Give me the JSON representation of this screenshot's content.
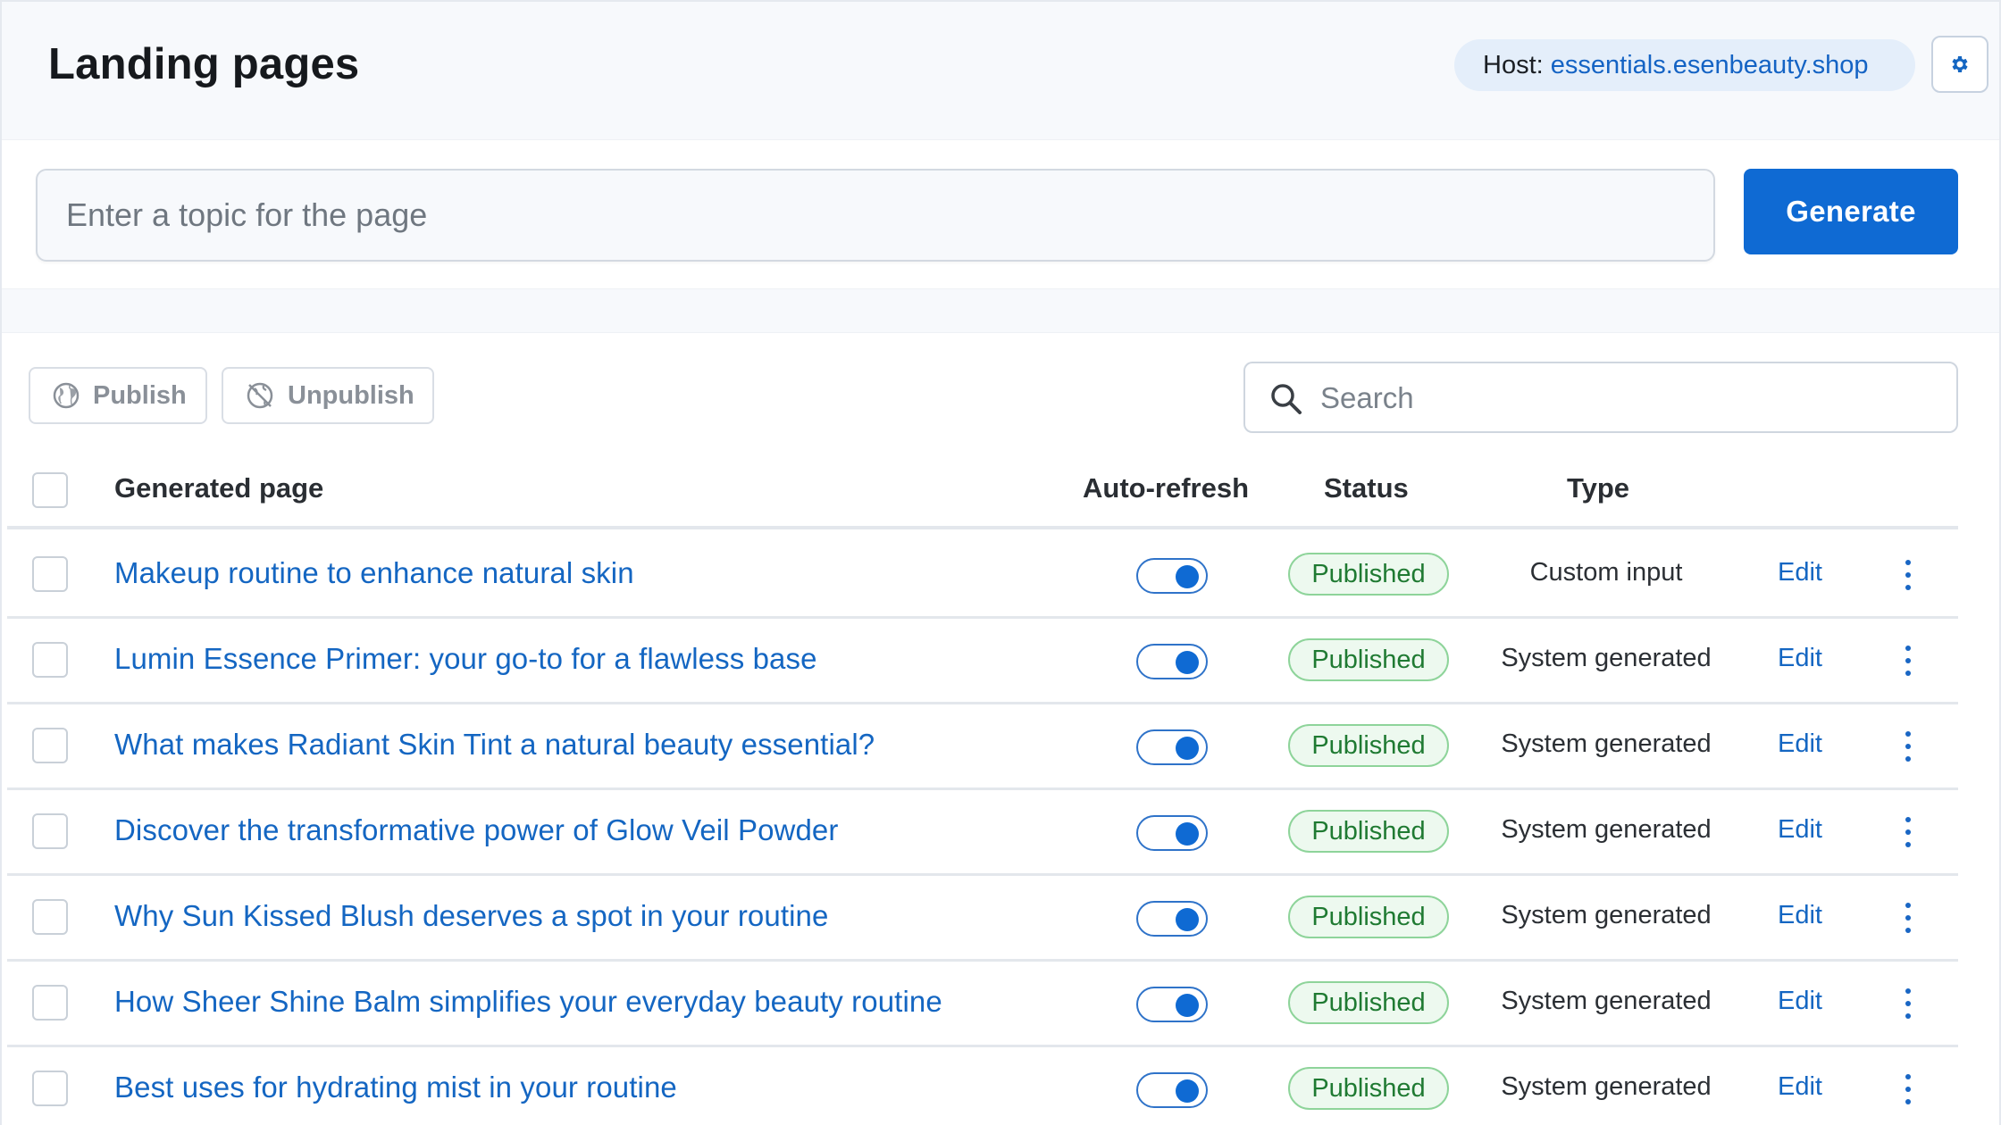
{
  "header": {
    "title": "Landing pages",
    "host_label": "Host:",
    "host_value": "essentials.esenbeauty.shop",
    "settings_icon": "gear-icon"
  },
  "generator": {
    "topic_placeholder": "Enter a topic for the page",
    "topic_value": "",
    "generate_label": "Generate"
  },
  "toolbar": {
    "publish_label": "Publish",
    "publish_icon": "globe-icon",
    "unpublish_label": "Unpublish",
    "unpublish_icon": "globe-off-icon",
    "search_placeholder": "Search",
    "search_icon": "search-icon"
  },
  "table": {
    "columns": {
      "page": "Generated page",
      "auto_refresh": "Auto-refresh",
      "status": "Status",
      "type": "Type"
    },
    "rows": [
      {
        "title": "Makeup routine to enhance natural skin",
        "auto_refresh": true,
        "status": "Published",
        "type": "Custom input",
        "action": "Edit"
      },
      {
        "title": "Lumin Essence Primer: your go-to for a flawless base",
        "auto_refresh": true,
        "status": "Published",
        "type": "System generated",
        "action": "Edit"
      },
      {
        "title": "What makes Radiant Skin Tint a natural beauty essential?",
        "auto_refresh": true,
        "status": "Published",
        "type": "System generated",
        "action": "Edit"
      },
      {
        "title": "Discover the transformative power of Glow Veil Powder",
        "auto_refresh": true,
        "status": "Published",
        "type": "System generated",
        "action": "Edit"
      },
      {
        "title": "Why Sun Kissed Blush deserves a spot in your routine",
        "auto_refresh": true,
        "status": "Published",
        "type": "System generated",
        "action": "Edit"
      },
      {
        "title": "How Sheer Shine Balm simplifies your everyday beauty routine",
        "auto_refresh": true,
        "status": "Published",
        "type": "System generated",
        "action": "Edit"
      },
      {
        "title": "Best uses for hydrating mist in your routine",
        "auto_refresh": true,
        "status": "Published",
        "type": "System generated",
        "action": "Edit"
      }
    ]
  },
  "colors": {
    "accent": "#0f6ad3",
    "link": "#1466c2",
    "status_published_bg": "#edf9ef",
    "status_published_text": "#1f7a32"
  }
}
